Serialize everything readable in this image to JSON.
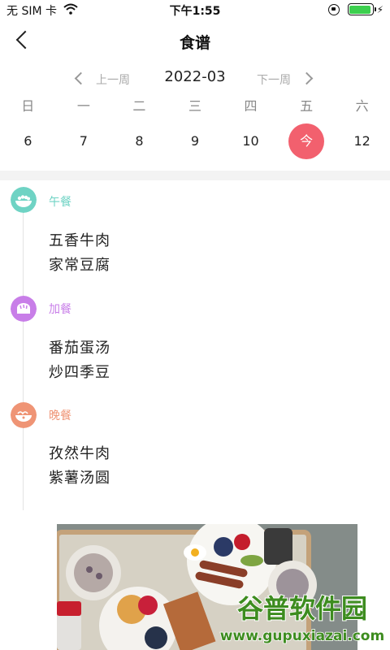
{
  "status_bar": {
    "carrier": "无 SIM 卡",
    "time": "下午1:55",
    "battery_level": 0.95,
    "icons": [
      "wifi-icon",
      "rotation-lock-icon",
      "battery-icon",
      "charging-icon"
    ]
  },
  "nav": {
    "title": "食谱",
    "back_icon": "chevron-left-icon"
  },
  "week_switch": {
    "prev_label": "上一周",
    "month": "2022-03",
    "next_label": "下一周"
  },
  "calendar": {
    "weekdays": [
      "日",
      "一",
      "二",
      "三",
      "四",
      "五",
      "六"
    ],
    "dates": [
      "6",
      "7",
      "8",
      "9",
      "10",
      "今",
      "12"
    ],
    "selected_index": 5
  },
  "meals": [
    {
      "label": "午餐",
      "color": "#6fd3c4",
      "icon": "rice-bowl-icon",
      "dishes": [
        "五香牛肉",
        "家常豆腐"
      ]
    },
    {
      "label": "加餐",
      "color": "#c87ee8",
      "icon": "bread-icon",
      "dishes": [
        "番茄蛋汤",
        "炒四季豆"
      ]
    },
    {
      "label": "晚餐",
      "color": "#ef9475",
      "icon": "noodle-bowl-icon",
      "dishes": [
        "孜然牛肉",
        "紫薯汤圆"
      ]
    }
  ],
  "colors": {
    "today": "#f2606e",
    "accent_muted": "#aaaaaa"
  },
  "watermark": {
    "title": "谷普软件园",
    "url": "www.gupuxiazai.com"
  }
}
